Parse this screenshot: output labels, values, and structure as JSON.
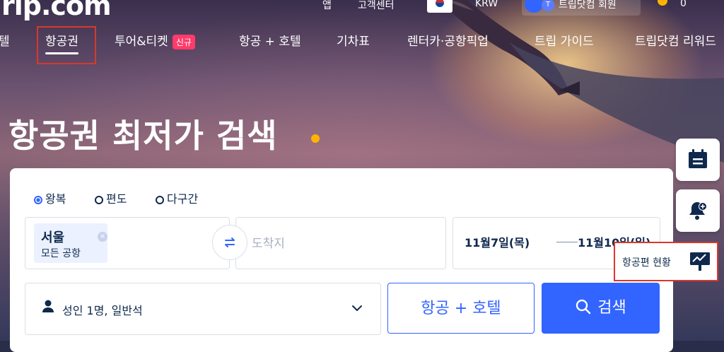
{
  "topbar": {
    "logo": "rip.com",
    "app": "앱",
    "customer_center": "고객센터",
    "currency": "KRW",
    "member": "트립닷컴 회원",
    "member_badge": "T",
    "coins": "0"
  },
  "nav": {
    "items": [
      {
        "label": "텔"
      },
      {
        "label": "항공권",
        "active": true
      },
      {
        "label": "투어&티켓",
        "badge": "신규"
      },
      {
        "label": "항공 + 호텔"
      },
      {
        "label": "기차표"
      },
      {
        "label": "렌터카·공항픽업"
      },
      {
        "label": "트립 가이드"
      },
      {
        "label": "트립닷컴 리워드"
      }
    ]
  },
  "headline": "항공권 최저가 검색",
  "search": {
    "trip_types": [
      {
        "label": "왕복",
        "selected": true
      },
      {
        "label": "편도",
        "selected": false
      },
      {
        "label": "다구간",
        "selected": false
      }
    ],
    "origin": {
      "city": "서울",
      "sub": "모든 공항"
    },
    "destination_placeholder": "도착지",
    "depart_date": "11월7일(목)",
    "return_date": "11월10일(일)",
    "passengers": "성인 1명, 일반석",
    "flight_hotel_button": "항공 + 호텔",
    "search_button": "검색"
  },
  "side": {
    "flight_status": "항공편 현황"
  },
  "colors": {
    "primary": "#3264ff",
    "accent": "#ffb300",
    "badge": "#ff3b6b",
    "highlight_box": "#d9382b"
  }
}
